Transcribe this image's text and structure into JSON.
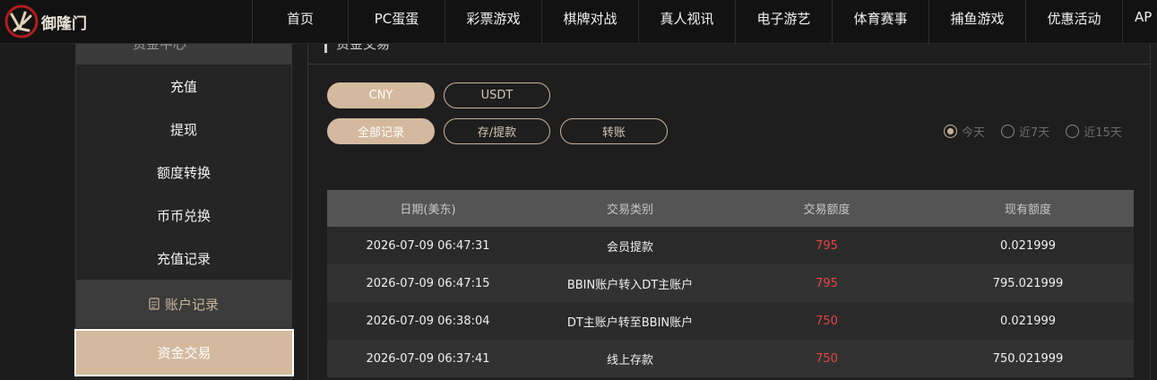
{
  "brand": {
    "name": "御隆门"
  },
  "nav": [
    "首页",
    "PC蛋蛋",
    "彩票游戏",
    "棋牌对战",
    "真人视讯",
    "电子游艺",
    "体育赛事",
    "捕鱼游戏",
    "优惠活动",
    "AP"
  ],
  "sidebar": {
    "header": "资金中心",
    "items": [
      "充值",
      "提现",
      "额度转换",
      "币币兑换",
      "充值记录"
    ],
    "section": "账户记录",
    "active": "资金交易"
  },
  "content": {
    "title": "资金交易",
    "currency_tabs": [
      "CNY",
      "USDT"
    ],
    "record_tabs": [
      "全部记录",
      "存/提款",
      "转账"
    ],
    "date_filters": [
      "今天",
      "近7天",
      "近15天"
    ]
  },
  "table": {
    "headers": [
      "日期(美东)",
      "交易类别",
      "交易额度",
      "现有额度"
    ],
    "rows": [
      [
        "2026-07-09 06:47:31",
        "会员提款",
        "795",
        "0.021999"
      ],
      [
        "2026-07-09 06:47:15",
        "BBIN账户转入DT主账户",
        "795",
        "795.021999"
      ],
      [
        "2026-07-09 06:38:04",
        "DT主账户转至BBIN账户",
        "750",
        "0.021999"
      ],
      [
        "2026-07-09 06:37:41",
        "线上存款",
        "750",
        "750.021999"
      ]
    ]
  },
  "colors": {
    "accent": "#d4b99e",
    "amount": "#e64545"
  }
}
